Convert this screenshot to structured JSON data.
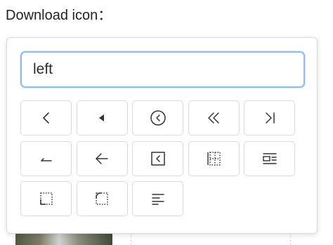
{
  "label": "Download icon：",
  "search": {
    "value": "left",
    "placeholder": ""
  },
  "icons": [
    {
      "name": "chevron-left-icon"
    },
    {
      "name": "caret-left-icon"
    },
    {
      "name": "circle-chevron-left-icon"
    },
    {
      "name": "double-chevron-left-icon"
    },
    {
      "name": "chevron-right-bar-icon"
    },
    {
      "name": "corner-down-left-icon"
    },
    {
      "name": "arrow-left-icon"
    },
    {
      "name": "square-chevron-left-icon"
    },
    {
      "name": "border-left-icon"
    },
    {
      "name": "text-wrap-left-icon"
    },
    {
      "name": "corner-bottom-left-icon"
    },
    {
      "name": "corner-top-left-icon"
    },
    {
      "name": "align-left-icon"
    }
  ]
}
